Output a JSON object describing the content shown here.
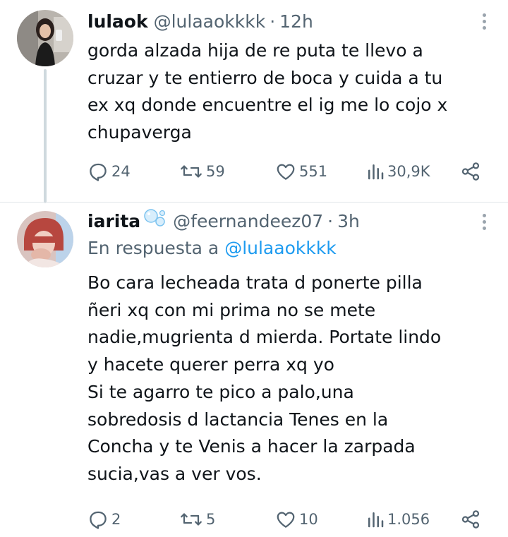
{
  "tweets": [
    {
      "name": "lulaok",
      "handle": "@lulaaokkkk",
      "separator": "·",
      "time": "12h",
      "text": "gorda alzada hija de re puta te llevo a\ncruzar y te entierro de boca y cuida a tu\nex xq donde encuentre el ig me lo cojo x\nchupaverga",
      "stats": {
        "replies": "24",
        "reposts": "59",
        "likes": "551",
        "views": "30,9K"
      }
    },
    {
      "name": "iarita",
      "handle": "@feernandeez07",
      "separator": "·",
      "time": "3h",
      "reply_prefix": "En respuesta a",
      "reply_mention": "@lulaaokkkk",
      "text": "Bo cara lecheada trata d ponerte pilla\nñeri xq con mi prima no se mete\nnadie,mugrienta d mierda. Portate lindo\ny hacete querer perra xq yo\nSi te agarro te pico a palo,una\nsobredosis d lactancia Tenes en la\nConcha y te Venis a hacer la zarpada\nsucia,vas a ver vos.",
      "stats": {
        "replies": "2",
        "reposts": "5",
        "likes": "10",
        "views": "1.056"
      }
    }
  ],
  "colors": {
    "text": "#0f1419",
    "secondary": "#536471",
    "link": "#1d9bf0",
    "thread_line": "#cfd9de"
  },
  "icons": [
    "reply-icon",
    "repost-icon",
    "like-icon",
    "views-icon",
    "share-icon",
    "more-icon",
    "bubbles-emoji"
  ]
}
